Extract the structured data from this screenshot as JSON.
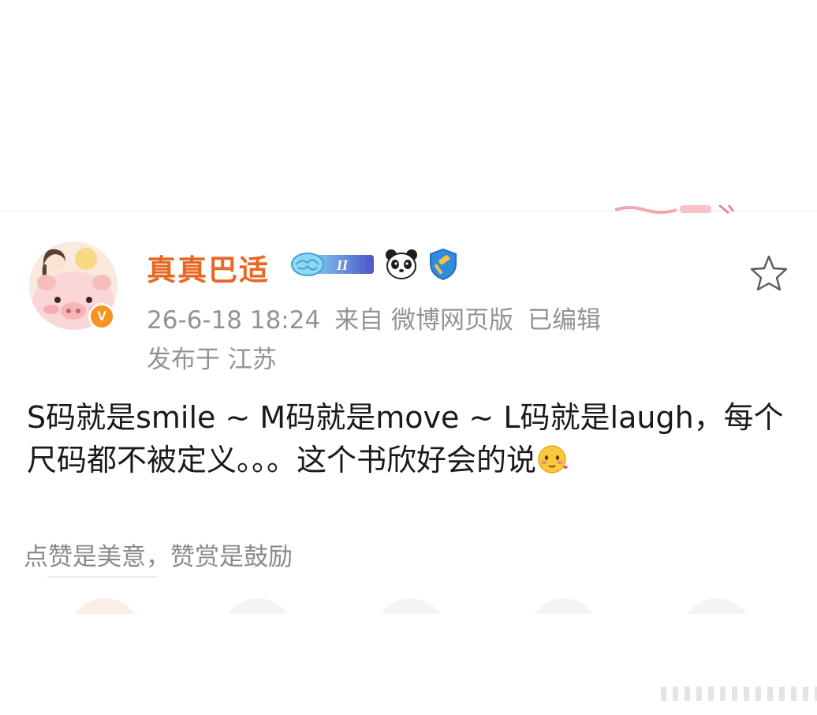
{
  "post": {
    "username": "真真巴适",
    "timestamp": "26-6-18 18:24",
    "source": "来自 微博网页版",
    "edited": "已编辑",
    "location": "发布于 江苏",
    "body": "S码就是smile ~ M码就是move ~ L码就是laugh，每个尺码都不被定义。。。这个书欣好会的说",
    "reward_prompt": "点赞是美意，赞赏是鼓励"
  },
  "badges": {
    "level_label": "II",
    "icons": [
      "brain-level-badge-icon",
      "panda-icon",
      "shield-gavel-icon"
    ]
  },
  "icons": {
    "verified": "verified-v-icon",
    "favorite": "star-outline-icon",
    "emoji": "shy-blush-emoji-icon"
  },
  "colors": {
    "username": "#e86722",
    "meta_text": "#939393",
    "body_text": "#1a1a1a",
    "verified_badge": "#f7931e"
  },
  "verified_label": "V"
}
